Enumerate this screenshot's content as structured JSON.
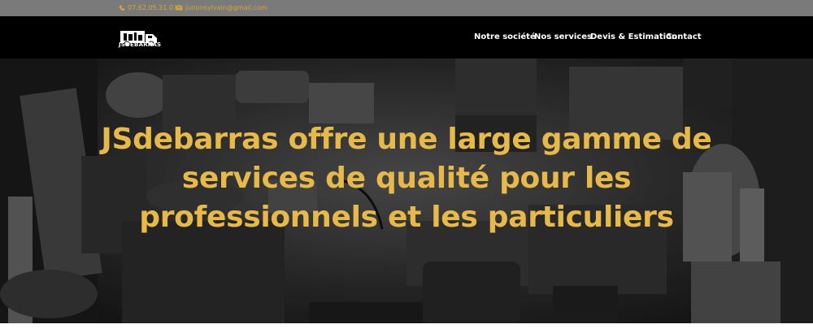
{
  "topbar": {
    "phone": "07.62.05.31.07",
    "email": "jurionsylvain@gmail.com",
    "phone_icon": "phone-icon",
    "email_icon": "envelope-icon",
    "accent_color": "#d8a636"
  },
  "header": {
    "logo_text": "JSDEBARRAS",
    "nav": [
      "Notre société",
      "Nos services",
      "Devis & Estimation",
      "Contact"
    ]
  },
  "hero": {
    "headline_lines": [
      "JSdebarras offre une large gamme de",
      "services de qualité pour les",
      "professionnels et les particuliers"
    ],
    "headline_color": "#e7b84a"
  }
}
